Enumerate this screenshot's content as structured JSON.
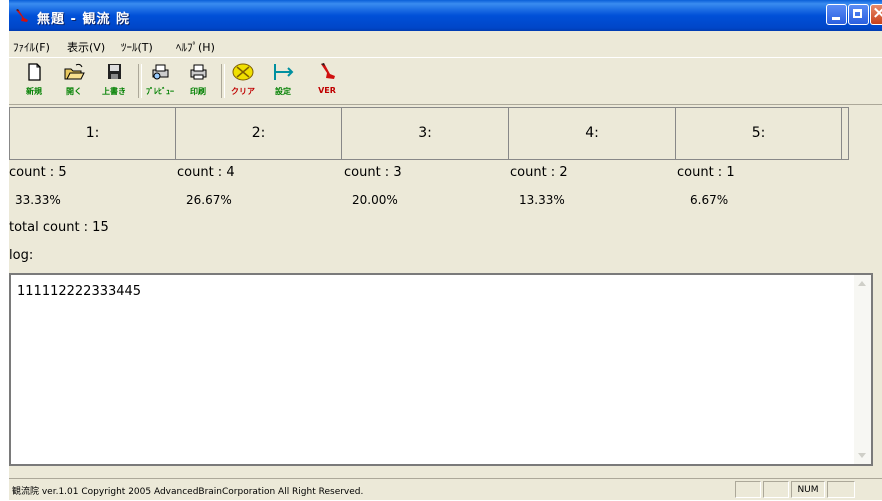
{
  "window": {
    "title": "無題 - 観流 院"
  },
  "menu": [
    "ﾌｧｲﾙ(F)",
    "表示(V)",
    "ﾂｰﾙ(T)",
    "ﾍﾙﾌﾟ(H)"
  ],
  "toolbar": [
    {
      "label": "新規",
      "icon": "new-document-icon"
    },
    {
      "label": "開く",
      "icon": "open-folder-icon"
    },
    {
      "label": "上書き",
      "icon": "save-icon"
    },
    {
      "label": "ﾌﾟﾚﾋﾞｭｰ",
      "icon": "print-preview-icon"
    },
    {
      "label": "印刷",
      "icon": "print-icon"
    },
    {
      "label": "クリア",
      "icon": "clear-icon"
    },
    {
      "label": "設定",
      "icon": "settings-icon"
    },
    {
      "label": "VER",
      "icon": "version-icon"
    }
  ],
  "columns": [
    {
      "header": "1:",
      "count": "count : 5",
      "percent": "33.33%"
    },
    {
      "header": "2:",
      "count": "count : 4",
      "percent": "26.67%"
    },
    {
      "header": "3:",
      "count": "count : 3",
      "percent": "20.00%"
    },
    {
      "header": "4:",
      "count": "count : 2",
      "percent": "13.33%"
    },
    {
      "header": "5:",
      "count": "count : 1",
      "percent": "6.67%"
    }
  ],
  "total": "total count : 15",
  "log": {
    "label": "log:",
    "value": "111112222333445"
  },
  "statusbar": {
    "text": "観流院 ver.1.01 Copyright 2005 AdvancedBrainCorporation All Right Reserved.",
    "num": "NUM"
  },
  "colors": {
    "titlebar": "#0050d8",
    "face": "#ece9d8",
    "toolbar_label": "#008000"
  }
}
